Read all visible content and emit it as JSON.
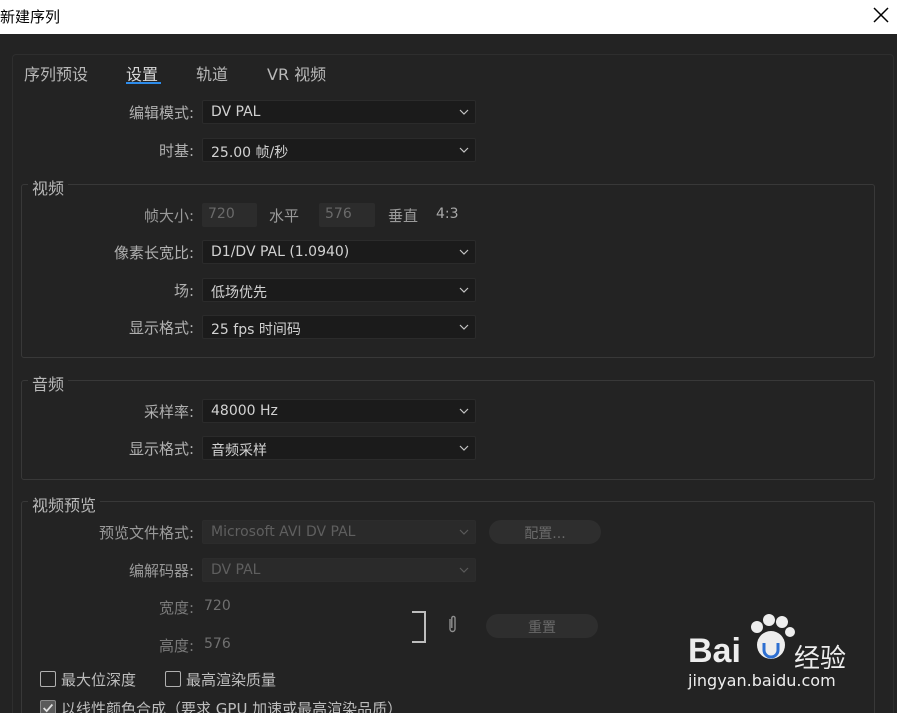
{
  "window": {
    "title": "新建序列"
  },
  "tabs": [
    {
      "label": "序列预设"
    },
    {
      "label": "设置"
    },
    {
      "label": "轨道"
    },
    {
      "label": "VR 视频"
    }
  ],
  "settings": {
    "edit_mode_label": "编辑模式:",
    "edit_mode_value": "DV PAL",
    "timebase_label": "时基:",
    "timebase_value": "25.00  帧/秒"
  },
  "video": {
    "title": "视频",
    "frame_size_label": "帧大小:",
    "frame_width": "720",
    "horizontal_label": "水平",
    "frame_height": "576",
    "vertical_label": "垂直",
    "aspect": "4:3",
    "pixel_aspect_label": "像素长宽比:",
    "pixel_aspect_value": "D1/DV PAL (1.0940)",
    "field_label": "场:",
    "field_value": "低场优先",
    "display_format_label": "显示格式:",
    "display_format_value": "25 fps 时间码"
  },
  "audio": {
    "title": "音频",
    "sample_rate_label": "采样率:",
    "sample_rate_value": "48000 Hz",
    "display_format_label": "显示格式:",
    "display_format_value": "音频采样"
  },
  "preview": {
    "title": "视频预览",
    "file_format_label": "预览文件格式:",
    "file_format_value": "Microsoft AVI DV PAL",
    "configure_label": "配置...",
    "codec_label": "编解码器:",
    "codec_value": "DV PAL",
    "width_label": "宽度:",
    "width_value": "720",
    "height_label": "高度:",
    "height_value": "576",
    "reset_label": "重置"
  },
  "options": {
    "max_bit_depth": "最大位深度",
    "max_render_quality": "最高渲染质量",
    "linear_color": "以线性颜色合成（要求 GPU 加速或最高渲染品质）"
  },
  "watermark": {
    "text1": "Bai",
    "text2": "经验",
    "url": "jingyan.baidu.com"
  },
  "colors": {
    "accent": "#2d8ceb",
    "background": "#232323",
    "field": "#1b1b1b"
  }
}
